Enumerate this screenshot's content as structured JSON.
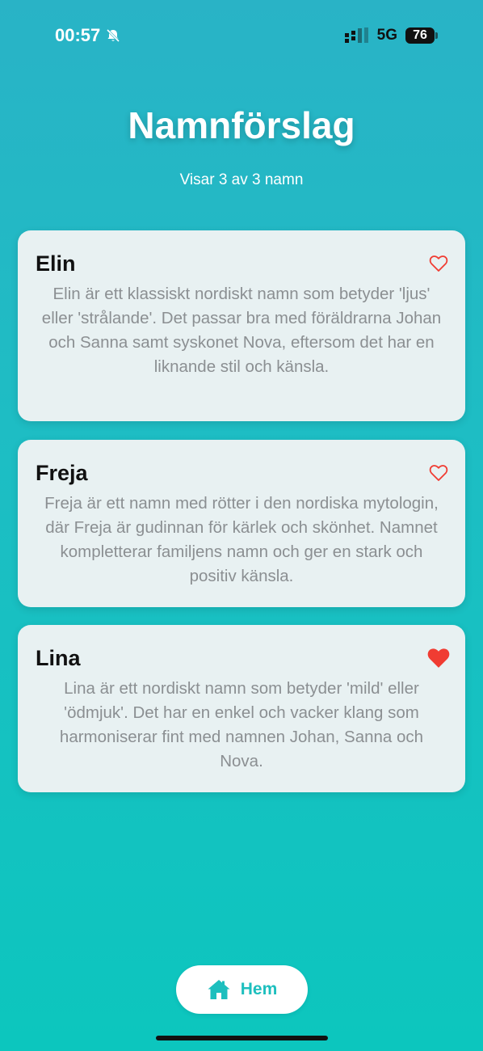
{
  "status_bar": {
    "time": "00:57",
    "network": "5G",
    "battery": "76"
  },
  "header": {
    "title": "Namnförslag",
    "subtitle": "Visar 3 av 3 namn"
  },
  "names": [
    {
      "name": "Elin",
      "description": "Elin är ett klassiskt nordiskt namn som betyder 'ljus' eller 'strålande'. Det passar bra med föräldrarna Johan och Sanna samt syskonet Nova, eftersom det har en liknande stil och känsla.",
      "favorite": false
    },
    {
      "name": "Freja",
      "description": "Freja är ett namn med rötter i den nordiska mytologin, där Freja är gudinnan för kärlek och skönhet. Namnet kompletterar familjens namn och ger en stark och positiv känsla.",
      "favorite": false
    },
    {
      "name": "Lina",
      "description": "Lina är ett nordiskt namn som betyder 'mild' eller 'ödmjuk'. Det har en enkel och vacker klang som harmoniserar fint med namnen Johan, Sanna och Nova.",
      "favorite": true
    }
  ],
  "home_button": {
    "label": "Hem",
    "icon": "house-icon"
  },
  "colors": {
    "accent": "#1dbfbe",
    "heart": "#f03c32"
  }
}
